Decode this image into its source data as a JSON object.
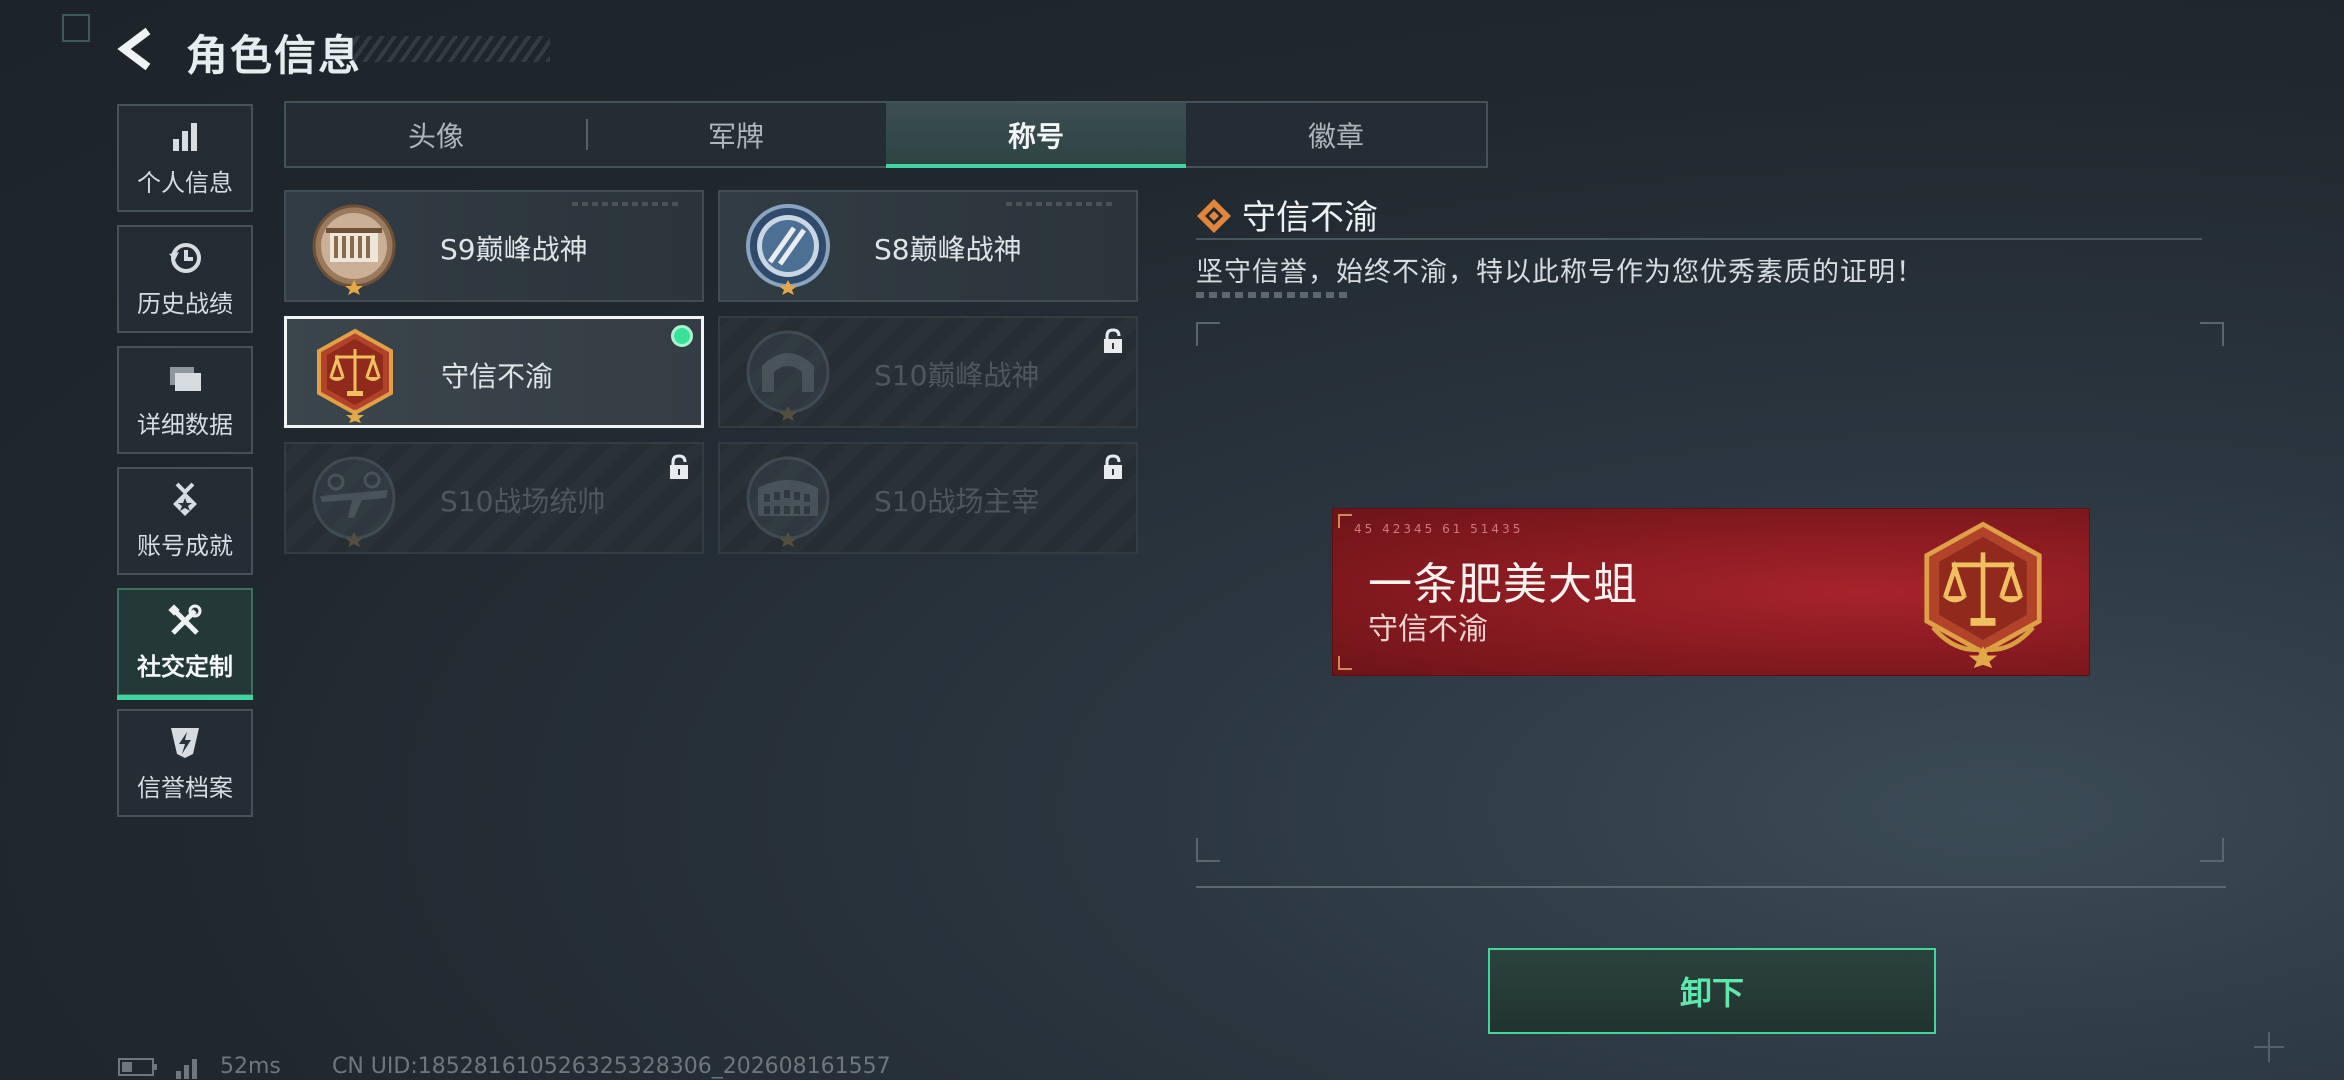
{
  "header": {
    "title": "角色信息",
    "back_icon": "back-arrow-icon"
  },
  "sidebar": {
    "items": [
      {
        "label": "个人信息",
        "icon": "bar-chart-icon",
        "active": false
      },
      {
        "label": "历史战绩",
        "icon": "history-clock-icon",
        "active": false
      },
      {
        "label": "详细数据",
        "icon": "folder-icon",
        "active": false
      },
      {
        "label": "账号成就",
        "icon": "medal-icon",
        "active": false
      },
      {
        "label": "社交定制",
        "icon": "tools-icon",
        "active": true
      },
      {
        "label": "信誉档案",
        "icon": "shield-bolt-icon",
        "active": false
      }
    ]
  },
  "tabs": [
    {
      "label": "头像",
      "active": false
    },
    {
      "label": "军牌",
      "active": false
    },
    {
      "label": "称号",
      "active": true
    },
    {
      "label": "徽章",
      "active": false
    }
  ],
  "titles": [
    {
      "name": "S9巅峰战神",
      "locked": false,
      "selected": false,
      "equipped": false,
      "medal": "bronze-gate"
    },
    {
      "name": "S8巅峰战神",
      "locked": false,
      "selected": false,
      "equipped": false,
      "medal": "blue-round"
    },
    {
      "name": "守信不渝",
      "locked": false,
      "selected": true,
      "equipped": true,
      "medal": "scales"
    },
    {
      "name": "S10巅峰战神",
      "locked": true,
      "selected": false,
      "equipped": false,
      "medal": "dark-arch"
    },
    {
      "name": "S10战场统帅",
      "locked": true,
      "selected": false,
      "equipped": false,
      "medal": "dark-plane"
    },
    {
      "name": "S10战场主宰",
      "locked": true,
      "selected": false,
      "equipped": false,
      "medal": "dark-colosseum"
    }
  ],
  "detail": {
    "title": "守信不渝",
    "description": "坚守信誉，始终不渝，特以此称号作为您优秀素质的证明！"
  },
  "banner": {
    "code": "45 42345  61 51435",
    "player_name": "一条肥美大蛆",
    "title": "守信不渝"
  },
  "actions": {
    "unequip_label": "卸下"
  },
  "status": {
    "ping": "52ms",
    "uid": "CN UID:185281610526325328306_202608161557"
  },
  "colors": {
    "accent": "#3fd4a0",
    "banner_red": "#8c1c22",
    "medal_gold": "#d99a3a"
  }
}
